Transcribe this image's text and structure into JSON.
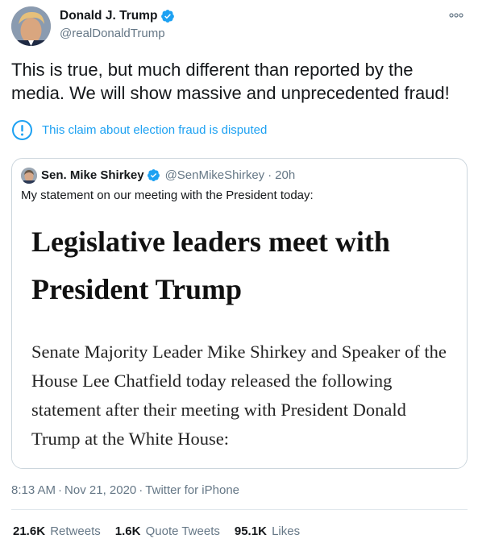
{
  "author": {
    "display_name": "Donald J. Trump",
    "handle": "@realDonaldTrump"
  },
  "tweet": {
    "text": "This is true, but much different than reported by the media. We will show massive and unprecedented fraud!",
    "dispute_label": "This claim about election fraud is disputed"
  },
  "quoted_tweet": {
    "display_name": "Sen. Mike Shirkey",
    "handle": "@SenMikeShirkey",
    "separator": "·",
    "time": "20h",
    "text": "My statement on our meeting with the President today:",
    "media": {
      "headline": "Legislative leaders meet with President Trump",
      "body": "Senate Majority Leader Mike Shirkey and Speaker of the House Lee Chatfield today released the following statement after their meeting with President Donald Trump at the White House:"
    }
  },
  "meta": {
    "time": "8:13 AM",
    "separator": "·",
    "date": "Nov 21, 2020",
    "source": "Twitter for iPhone"
  },
  "stats": {
    "retweets_count": "21.6K",
    "retweets_label": "Retweets",
    "quotes_count": "1.6K",
    "quotes_label": "Quote Tweets",
    "likes_count": "95.1K",
    "likes_label": "Likes"
  },
  "colors": {
    "link_blue": "#1da1f2",
    "secondary_text": "#657786",
    "border": "#ccd6dd"
  },
  "icons": {
    "verified": "verified-badge-icon",
    "more": "more-options-icon",
    "dispute": "exclamation-circle-icon"
  }
}
